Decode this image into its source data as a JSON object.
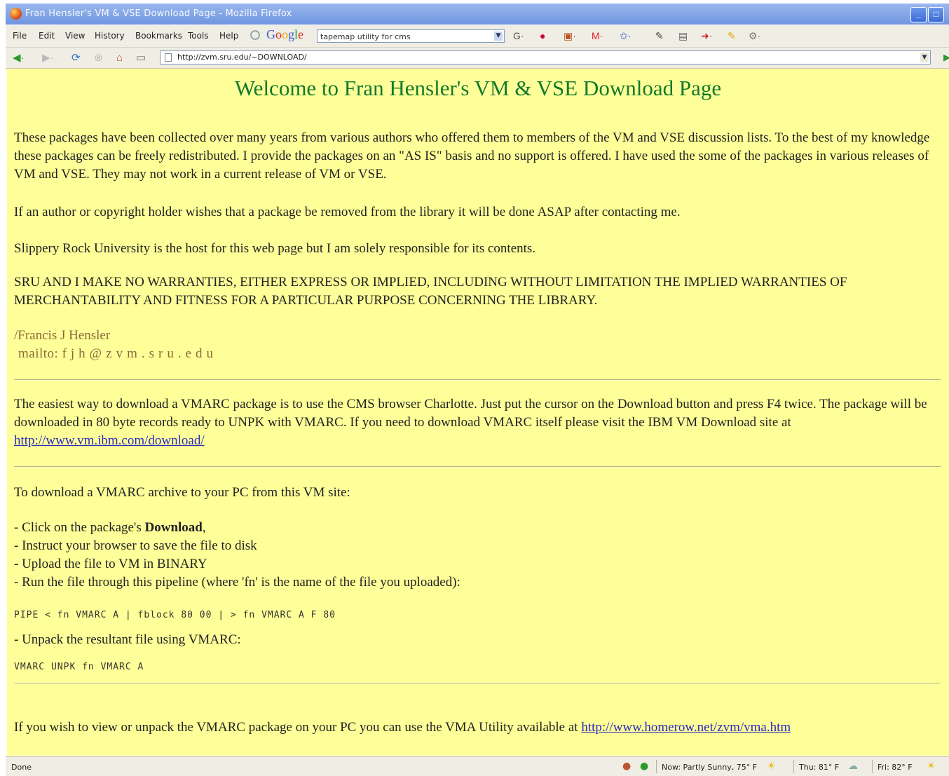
{
  "window": {
    "title": "Fran Hensler's VM & VSE Download Page - Mozilla Firefox"
  },
  "menu": {
    "items": [
      "File",
      "Edit",
      "View",
      "History",
      "Bookmarks",
      "Tools",
      "Help"
    ]
  },
  "toolbar": {
    "google_label": "Google",
    "search_value": "tapemap utility for cms"
  },
  "nav": {
    "url": "http://zvm.sru.edu/~DOWNLOAD/"
  },
  "page": {
    "heading": "Welcome to Fran Hensler's VM & VSE Download Page",
    "intro": "These packages have been collected over many years from various authors who offered them to members of the VM and VSE discussion lists.  To the best of my knowledge these packages can be freely redistributed. I provide the packages on an \"AS IS\" basis and no support is offered.  I have used the some of the packages in various releases of VM and VSE.  They may not work in a current release of VM or VSE.",
    "removal": "If an author or copyright holder wishes that a package be removed from the library it will be done ASAP after contacting me.",
    "host": "Slippery Rock University is the host for this web page but I am solely responsible for its contents.",
    "warranty": "SRU AND I MAKE NO WARRANTIES, EITHER EXPRESS OR IMPLIED, INCLUDING WITHOUT LIMITATION THE IMPLIED WARRANTIES OF MERCHANTABILITY AND FITNESS FOR A PARTICULAR PURPOSE CONCERNING THE LIBRARY.",
    "signature": "/Francis J Hensler",
    "mailto_label": "mailto:",
    "mail_address": "fjh@zvm.sru.edu",
    "charlotte_text": "The easiest way to download a VMARC package is to use the CMS browser Charlotte.  Just put the cursor on the Download button and press F4 twice.  The package will be downloaded in 80 byte records ready to UNPK with VMARC.  If you need to download VMARC itself please visit the IBM VM Download site at ",
    "ibm_link": "http://www.vm.ibm.com/download/",
    "pc_intro": "To download a VMARC archive to your PC from this VM site:",
    "step1_prefix": "- Click on the package's ",
    "step1_bold": "Download",
    "step1_suffix": ",",
    "step2": "- Instruct your browser to save the file to disk",
    "step3": "- Upload the file to VM in BINARY",
    "step4": "- Run the file through this pipeline (where 'fn' is the name of the file you uploaded):",
    "pipe_cmd": "PIPE < fn VMARC A | fblock 80 00 | > fn VMARC A F 80",
    "step5": "- Unpack the resultant file using VMARC:",
    "unpk_cmd": "VMARC UNPK fn VMARC A",
    "vma_text": "If you wish to view or unpack the VMARC package on your PC you can use the VMA Utility available at ",
    "vma_link": "http://www.homerow.net/zvm/vma.htm"
  },
  "status": {
    "text": "Done",
    "weather_now": "Now: Partly Sunny, 75° F",
    "weather_thu": "Thu: 81° F",
    "weather_fri": "Fri: 82° F"
  },
  "colors": {
    "page_bg": "#ffff99",
    "heading": "#127a2b",
    "link": "#2b2bbf",
    "signature": "#8a6a3a"
  }
}
